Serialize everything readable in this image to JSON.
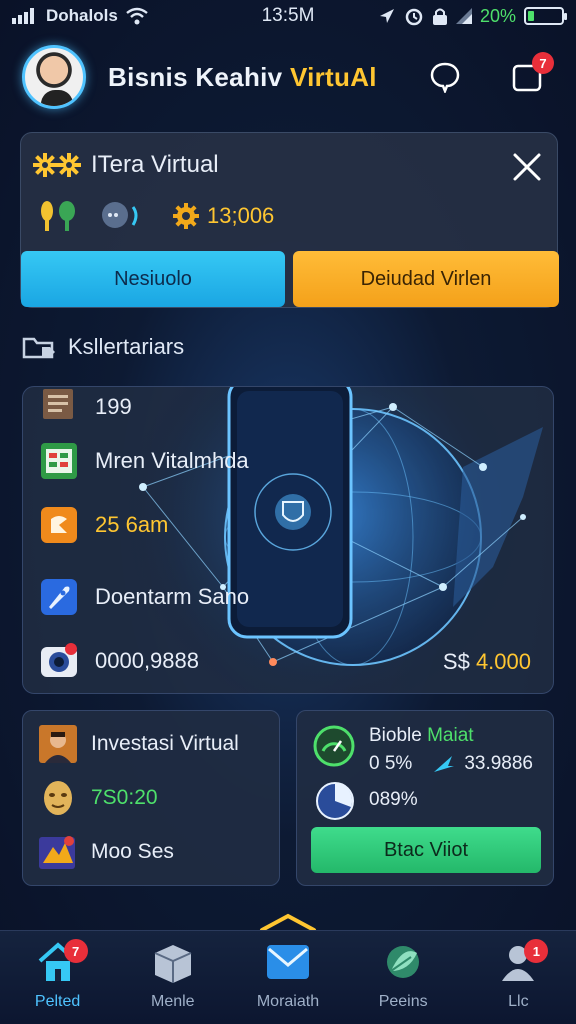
{
  "status_bar": {
    "carrier": "Dohalols",
    "time": "13:5M",
    "battery": "20%",
    "battery_level": 0.2
  },
  "header": {
    "title_main": "Bisnis Keahiv ",
    "title_accent": "VirtuAl",
    "notification_count": "7"
  },
  "top_card": {
    "title": "ITera Virtual",
    "stat_value": "13;006",
    "primary_button": "Nesiuolo",
    "secondary_button": "Deiudad Virlen"
  },
  "section": {
    "label": "Ksllertariars"
  },
  "mid_card": {
    "items": [
      {
        "label": "199",
        "icon": "document-icon"
      },
      {
        "label": "Mren Vitalmhda",
        "icon": "spreadsheet-icon"
      },
      {
        "label": "25 6am",
        "icon": "orange-app-icon"
      },
      {
        "label": "Doentarm Sano",
        "icon": "rocket-icon"
      },
      {
        "label": "0000,9888",
        "icon": "camera-icon"
      }
    ],
    "price_prefix": "S$ ",
    "price_value": "4.000"
  },
  "card_left": {
    "title": "Investasi Virtual",
    "value": "7S0:20",
    "footer": "Moo Ses"
  },
  "card_right": {
    "title_main": "Bioble ",
    "title_accent": "Maiat",
    "percent_1": "0 5%",
    "value": "33.9886",
    "percent_2": "089%",
    "button": "Btac Viiot"
  },
  "bottom_nav": {
    "items": [
      {
        "label": "Pelted",
        "badge": "7"
      },
      {
        "label": "Menle",
        "badge": ""
      },
      {
        "label": "Moraiath",
        "badge": ""
      },
      {
        "label": "Peeins",
        "badge": ""
      },
      {
        "label": "Llc",
        "badge": "1"
      }
    ]
  },
  "colors": {
    "accent_blue": "#36c8f4",
    "accent_gold": "#ffc631",
    "accent_green": "#3fdc8c",
    "badge_red": "#e82f3a"
  }
}
